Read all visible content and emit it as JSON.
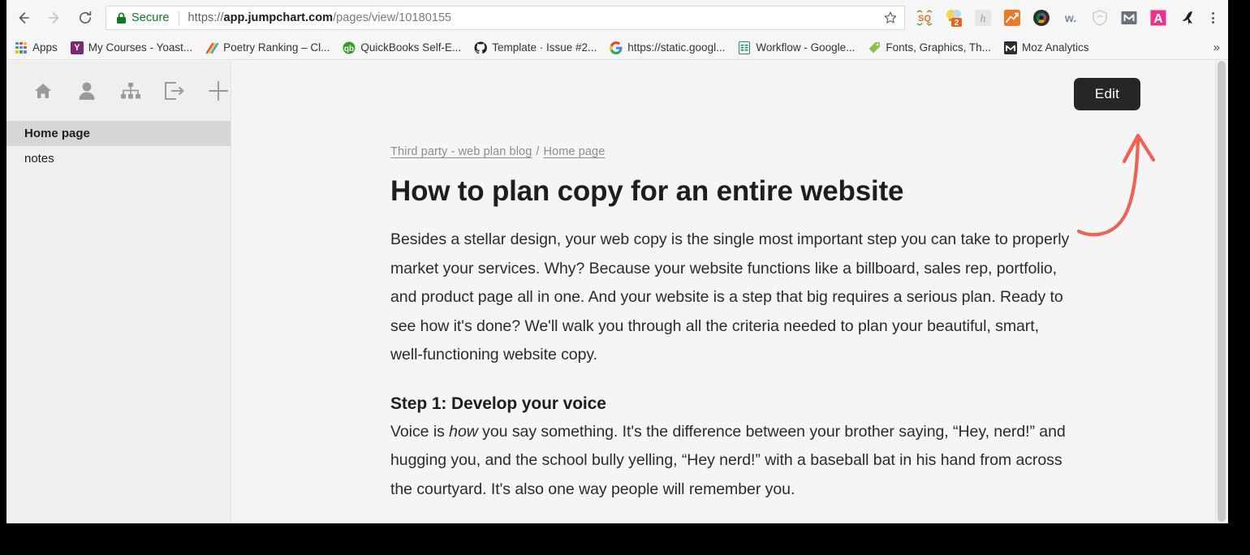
{
  "browser": {
    "back_icon": "back-arrow-icon",
    "forward_icon": "forward-arrow-icon",
    "reload_icon": "reload-icon",
    "security_label": "Secure",
    "lock_icon": "lock-icon",
    "url_scheme": "https://",
    "url_host": "app.jumpchart.com",
    "url_path": "/pages/view/10180155",
    "url_full": "https://app.jumpchart.com/pages/view/10180155",
    "star_icon": "star-icon",
    "menu_icon": "three-dot-menu-icon",
    "extensions": [
      {
        "name": "seoquake-extension-icon",
        "glyph": "SQ",
        "color": "#6aa84f",
        "bg": "transparent"
      },
      {
        "name": "lightbulb-extension-icon",
        "glyph": "2",
        "color": "#ffffff",
        "bg": "#e8641c"
      },
      {
        "name": "hypothesis-extension-icon",
        "glyph": "h",
        "color": "#9a9a9a",
        "bg": "#e3e3e3"
      },
      {
        "name": "analytics-extension-icon",
        "glyph": "",
        "color": "#ffffff",
        "bg": "#f07a23"
      },
      {
        "name": "camera-lens-extension-icon",
        "glyph": "",
        "color": "#ffffff",
        "bg": "#3b3b3b"
      },
      {
        "name": "wordpress-extension-icon",
        "glyph": "w.",
        "color": "#7b8794",
        "bg": "transparent"
      },
      {
        "name": "shield-extension-icon",
        "glyph": "",
        "color": "#c6c6c6",
        "bg": "transparent"
      },
      {
        "name": "mailbox-extension-icon",
        "glyph": "M",
        "color": "#ffffff",
        "bg": "#6b7277"
      },
      {
        "name": "adobe-extension-icon",
        "glyph": "A",
        "color": "#ffffff",
        "bg": "#f0308c"
      },
      {
        "name": "bird-extension-icon",
        "glyph": "",
        "color": "#1d1d1d",
        "bg": "transparent"
      }
    ],
    "bookmarks": [
      {
        "name": "bookmark-apps",
        "label": "Apps",
        "icon": "apps-grid-icon",
        "glyph": "",
        "bg": "transparent",
        "fg": "#ffffff"
      },
      {
        "name": "bookmark-my-courses",
        "label": "My Courses - Yoast...",
        "icon": "yoast-icon",
        "glyph": "Y",
        "bg": "#7a2a73",
        "fg": "#ffffff"
      },
      {
        "name": "bookmark-poetry-ranking",
        "label": "Poetry Ranking – Cl...",
        "icon": "rainbow-icon",
        "glyph": "",
        "bg": "transparent",
        "fg": "#ffffff"
      },
      {
        "name": "bookmark-quickbooks",
        "label": "QuickBooks Self-E...",
        "icon": "quickbooks-icon",
        "glyph": "qb",
        "bg": "#2ca01c",
        "fg": "#ffffff"
      },
      {
        "name": "bookmark-template-issue",
        "label": "Template · Issue #2...",
        "icon": "github-icon",
        "glyph": "",
        "bg": "#ffffff",
        "fg": "#1b1f23"
      },
      {
        "name": "bookmark-static-google",
        "label": "https://static.googl...",
        "icon": "google-icon",
        "glyph": "G",
        "bg": "transparent",
        "fg": "#4285f4"
      },
      {
        "name": "bookmark-workflow",
        "label": "Workflow - Google...",
        "icon": "google-sheets-icon",
        "glyph": "",
        "bg": "#0f9d58",
        "fg": "#ffffff"
      },
      {
        "name": "bookmark-fonts-graphics",
        "label": "Fonts, Graphics, Th...",
        "icon": "creative-market-icon",
        "glyph": "",
        "bg": "#8bc34a",
        "fg": "#ffffff"
      },
      {
        "name": "bookmark-moz-analytics",
        "label": "Moz Analytics",
        "icon": "moz-icon",
        "glyph": "M",
        "bg": "#2d2d2d",
        "fg": "#ffffff"
      }
    ],
    "bookmarks_overflow_label": "»"
  },
  "app": {
    "sidebar": {
      "tools": [
        {
          "name": "home-icon",
          "title": "Home"
        },
        {
          "name": "user-icon",
          "title": "Account"
        },
        {
          "name": "sitemap-icon",
          "title": "Sitemap"
        },
        {
          "name": "export-icon",
          "title": "Export"
        },
        {
          "name": "add-page-icon",
          "title": "Add page"
        }
      ],
      "pages": [
        {
          "name": "sidebar-page-home-page",
          "label": "Home page",
          "active": true
        },
        {
          "name": "sidebar-page-notes",
          "label": "notes",
          "active": false
        }
      ]
    },
    "edit_button_label": "Edit",
    "annotation_arrow_color": "#f4604f",
    "breadcrumb": {
      "parent": "Third party - web plan blog",
      "separator": "/",
      "current": "Home page"
    },
    "document": {
      "title": "How to plan copy for an entire website",
      "paragraph_1": "Besides a stellar design, your web copy is the single most important step you can take to properly market your services. Why? Because your website functions like a billboard, sales rep, portfolio, and product page all in one. And your website is a step that big requires a serious plan. Ready to see how it's done? We'll walk you through all the criteria needed to plan your beautiful, smart, well-functioning website copy.",
      "heading_step_1": "Step 1: Develop your voice",
      "paragraph_2_part_1": "Voice is ",
      "paragraph_2_emphasis": "how",
      "paragraph_2_part_2": " you say something. It's the difference between your brother saying, “Hey, nerd!” and hugging you, and the school bully yelling, “Hey nerd!” with a baseball bat in his hand from across the courtyard. It's also one way people will remember you."
    }
  }
}
